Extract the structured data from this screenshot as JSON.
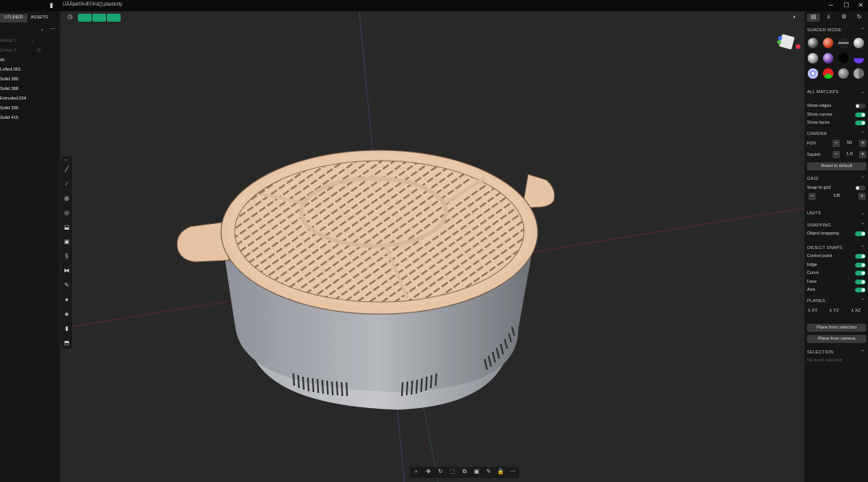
{
  "window": {
    "title": "ÚÅÅþé©ÞÆ©Þâ▒.plasticity",
    "minimize": "─",
    "maximize": "☐",
    "close": "✕"
  },
  "outliner": {
    "tabs": [
      "UTLINER",
      "ASSETS"
    ],
    "items": [
      {
        "label": "Group 1",
        "dim": true
      },
      {
        "label": "Group 2",
        "dim": true
      },
      {
        "label": "ds",
        "dim": false
      },
      {
        "label": "Lofted.001",
        "dim": false
      },
      {
        "label": "Solid 380",
        "dim": false
      },
      {
        "label": "Solid 388",
        "dim": false
      },
      {
        "label": "Extruded.004",
        "dim": false
      },
      {
        "label": "Solid 396",
        "dim": false
      },
      {
        "label": "Solid 415",
        "dim": false
      }
    ]
  },
  "viewport": {
    "toolbar_label": "xx",
    "bottom_icons": [
      "⌕",
      "✥",
      "↻",
      "⬚",
      "⧉",
      "▣",
      "✎",
      "🔒",
      "⋯"
    ],
    "colors": {
      "background": "#282828",
      "lid": "#e7c4a3",
      "pot": "#a9acb2",
      "accent": "#1aa570"
    }
  },
  "right_panel": {
    "shader_mode": {
      "title": "SHADER MODE"
    },
    "all_matcaps": {
      "title": "ALL MATCAPS"
    },
    "display": [
      {
        "label": "Show edges",
        "on": false
      },
      {
        "label": "Show curves",
        "on": true
      },
      {
        "label": "Show faces",
        "on": true
      }
    ],
    "camera": {
      "title": "CAMERA",
      "fov_label": "FOV",
      "fov_value": "50",
      "squish_label": "Squish",
      "squish_value": "1.0",
      "reset": "Reset to default"
    },
    "grid": {
      "title": "GRID",
      "snap_label": "Snap to grid",
      "snap_on": false,
      "value": "1/8"
    },
    "units": {
      "title": "UNITS"
    },
    "snapping": {
      "title": "SNAPPING",
      "object_label": "Object snapping",
      "object_on": true
    },
    "object_snaps": {
      "title": "OBJECT SNAPS",
      "items": [
        {
          "label": "Control point",
          "on": true
        },
        {
          "label": "Edge",
          "on": true
        },
        {
          "label": "Curve",
          "on": true
        },
        {
          "label": "Face",
          "on": true
        },
        {
          "label": "Axis",
          "on": true
        }
      ]
    },
    "planes": {
      "title": "PLANES",
      "items": [
        "XY",
        "YZ",
        "XZ"
      ],
      "from_selection": "Plane from selection",
      "from_camera": "Plane from camera"
    },
    "selection": {
      "title": "SELECTION",
      "empty": "No items selected"
    }
  }
}
